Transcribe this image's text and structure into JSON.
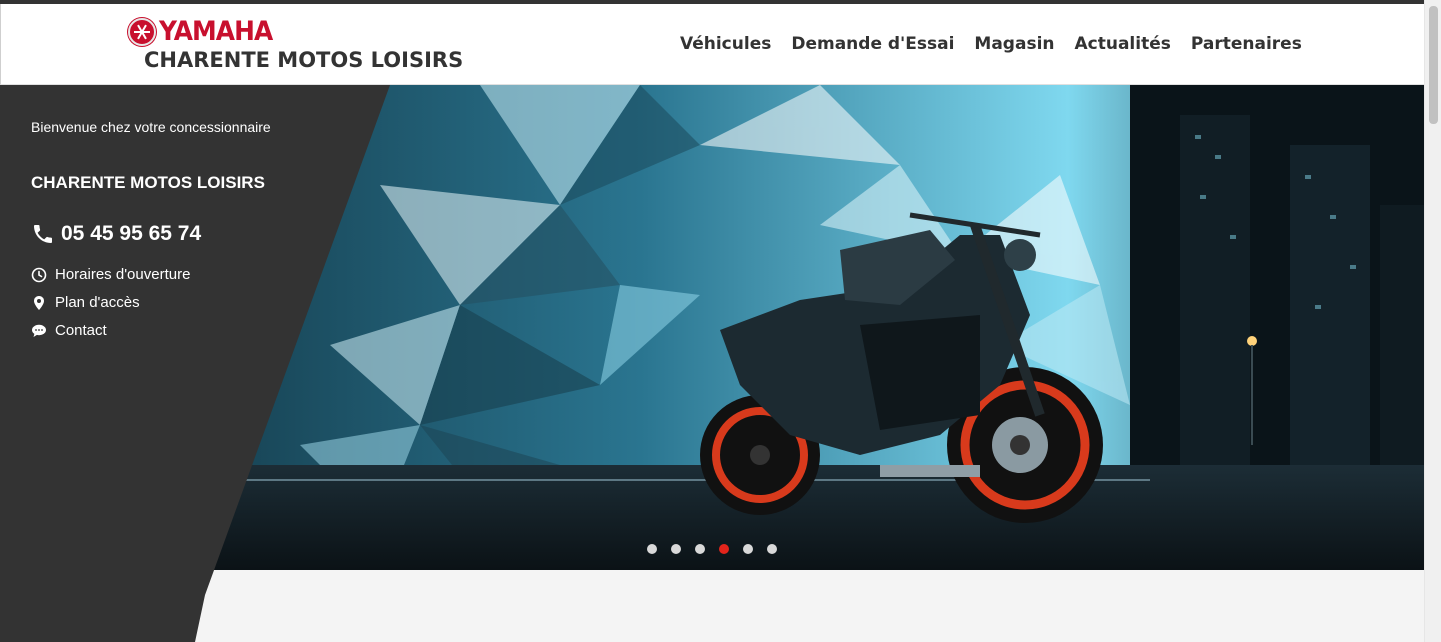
{
  "brand": {
    "logo_text": "YAMAHA",
    "dealer_name": "CHARENTE MOTOS LOISIRS",
    "logo_color": "#c8102e"
  },
  "nav": {
    "items": [
      "Véhicules",
      "Demande d'Essai",
      "Magasin",
      "Actualités",
      "Partenaires"
    ]
  },
  "panel": {
    "welcome": "Bienvenue chez votre concessionnaire",
    "name": "CHARENTE MOTOS LOISIRS",
    "phone": "05 45 95 65 74",
    "links": [
      {
        "label": "Horaires d'ouverture",
        "icon": "clock-icon"
      },
      {
        "label": "Plan d'accès",
        "icon": "map-pin-icon"
      },
      {
        "label": "Contact",
        "icon": "chat-icon"
      }
    ],
    "background": "#333333"
  },
  "slider": {
    "slide_count": 6,
    "active_index": 3,
    "active_color": "#e3241b",
    "inactive_color": "#d9d9d9"
  },
  "colors": {
    "page_background": "#f4f4f4",
    "header_background": "#ffffff",
    "text_dark": "#333333"
  }
}
